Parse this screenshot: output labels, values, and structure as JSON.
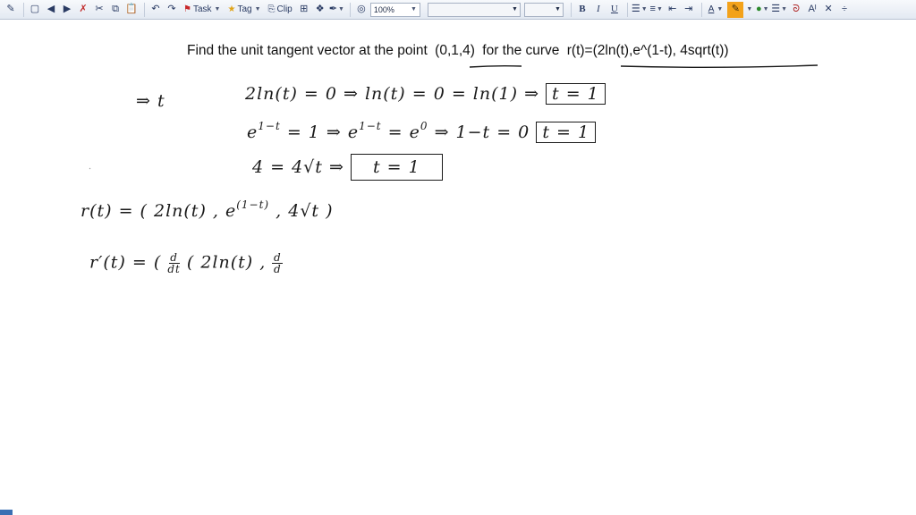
{
  "toolbar": {
    "zoom": "100%",
    "task_label": "Task",
    "tag_label": "Tag",
    "clip_label": "Clip",
    "bold": "B",
    "italic": "I",
    "underline": "U",
    "font_color_label": "A",
    "text_size_label": "Aᴵ",
    "icons": [
      "pen-icon",
      "new-page-icon",
      "back-icon",
      "forward-icon",
      "delete-icon",
      "cut-icon",
      "copy-icon",
      "paste-icon",
      "undo-icon",
      "redo-icon",
      "task-flag-icon",
      "tag-star-icon",
      "clip-icon",
      "table-icon",
      "insert-icon",
      "pen-tool-icon",
      "web-icon",
      "bullets-icon",
      "numbering-icon",
      "decrease-indent-icon",
      "increase-indent-icon",
      "font-color-icon",
      "highlighter-icon",
      "pen-color-icon",
      "line-style-icon",
      "lasso-icon",
      "text-size-icon",
      "eraser-icon",
      "split-icon"
    ]
  },
  "problem": {
    "prefix": "Find the unit tangent vector at the point",
    "point": "(0,1,4)",
    "middle": "for the curve",
    "curve": "r(t)=(2ln(t),e^(1-t), 4sqrt(t))"
  },
  "handwriting": {
    "line1_lead": "⇒ t",
    "line1": "2ln(t) = 0  ⇒  ln(t) = 0 = ln(1)  ⇒",
    "line1_box": "t = 1",
    "line2_a": "e",
    "line2_a_sup": "1−t",
    "line2_b": "= 1   ⇒   e",
    "line2_b_sup": "1−t",
    "line2_c": "= e",
    "line2_c_sup": "0",
    "line2_d": "⇒ 1−t = 0",
    "line2_box": "t = 1",
    "line3": "4 = 4√t   ⇒",
    "line3_box": "t = 1",
    "line4": "r(t) = ( 2ln(t) , e",
    "line4_sup": "(1−t)",
    "line4_end": ",  4√t )",
    "line5": "r′(t) =  (",
    "line5_frac_num": "d",
    "line5_frac_den": "dt",
    "line5_mid": "( 2ln(t) ,",
    "line5_frac2_num": "d",
    "line5_frac2_den": "d"
  },
  "colors": {
    "toolbar_bg": "#e3e9f2",
    "ink": "#1a1a1a",
    "highlighter": "#f3a21a"
  }
}
